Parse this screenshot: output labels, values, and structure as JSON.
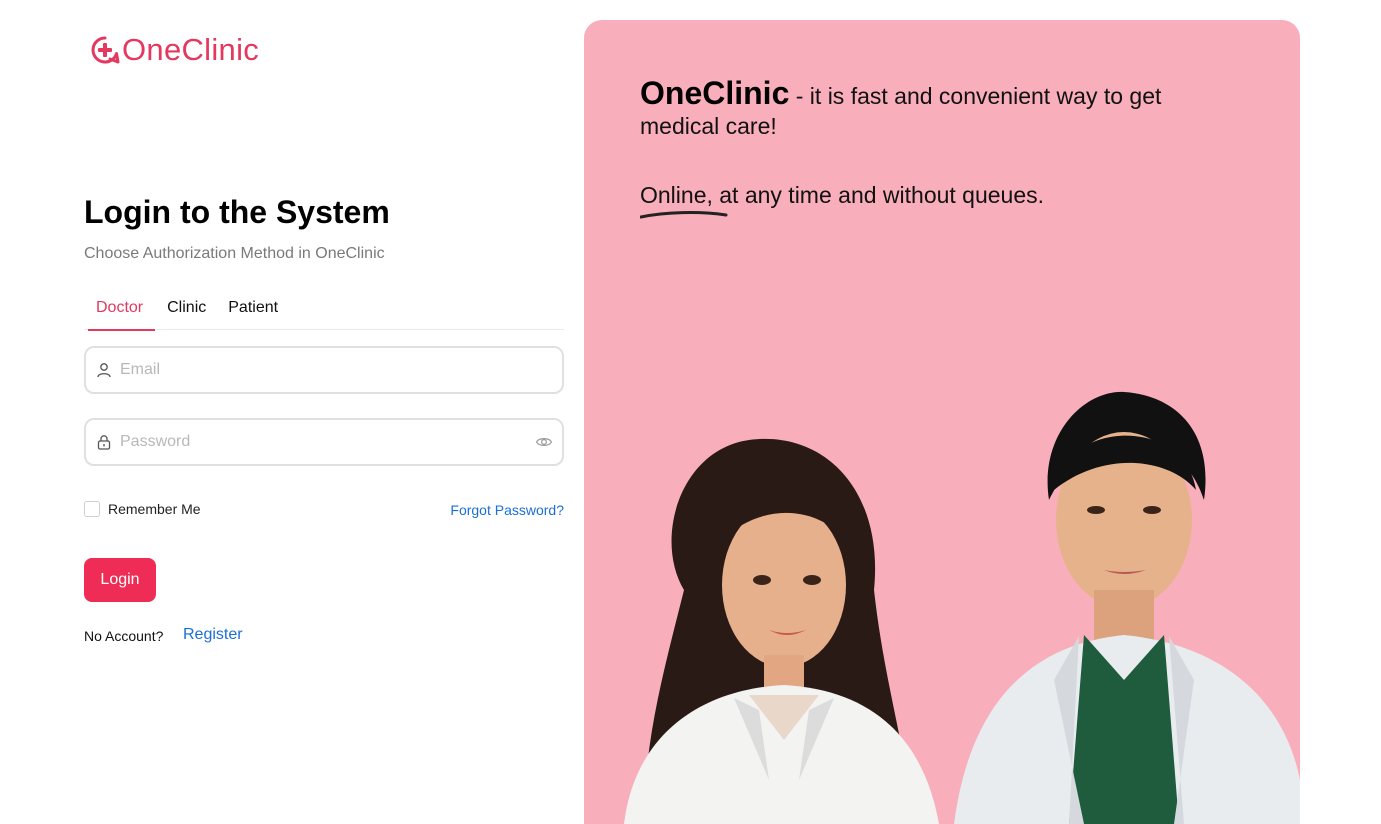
{
  "brand": {
    "logo_text": "OneClinic",
    "accent_color": "#e5385f",
    "logo_icon": "medical-cross-bubble-icon"
  },
  "login": {
    "title": "Login to the System",
    "subtitle": "Choose Authorization Method in OneClinic",
    "tabs": [
      {
        "label": "Doctor",
        "active": true
      },
      {
        "label": "Clinic",
        "active": false
      },
      {
        "label": "Patient",
        "active": false
      }
    ],
    "email": {
      "placeholder": "Email",
      "value": "",
      "icon": "user-icon"
    },
    "password": {
      "placeholder": "Password",
      "value": "",
      "icon": "lock-icon",
      "toggle_icon": "eye-icon"
    },
    "remember_label": "Remember Me",
    "remember_checked": false,
    "forgot_label": "Forgot Password?",
    "submit_label": "Login",
    "submit_color": "#ef2c55",
    "no_account_label": "No Account?",
    "register_label": "Register",
    "link_color": "#1a6fd6"
  },
  "hero": {
    "background": "#f9aebb",
    "brand": "OneClinic",
    "tagline": " - it is fast and convenient way to get medical care!",
    "line2": "Online, at any time and without queues.",
    "image": "two-smiling-doctors-in-white-coats"
  }
}
